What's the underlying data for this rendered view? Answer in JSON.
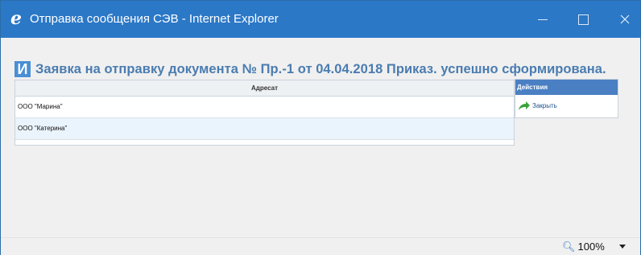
{
  "window": {
    "title": "Отправка сообщения СЭВ - Internet Explorer",
    "icon": "internet-explorer-icon"
  },
  "heading": {
    "badge": "И",
    "text": "Заявка на отправку документа № Пр.-1 от 04.04.2018 Приказ. успешно сформирована."
  },
  "table": {
    "column_header": "Адресат",
    "rows": [
      "ООО \"Марина\"",
      "ООО \"Катерина\""
    ]
  },
  "actions": {
    "header": "Действия",
    "close_label": "Закрыть",
    "close_icon": "green-arrow-icon"
  },
  "status": {
    "zoom": "100%",
    "zoom_icon": "magnifier-icon"
  },
  "colors": {
    "titlebar": "#2b78c7",
    "heading_text": "#4a7cb0",
    "actions_header": "#4a80c3",
    "row_highlight": "#eaf4fc"
  }
}
